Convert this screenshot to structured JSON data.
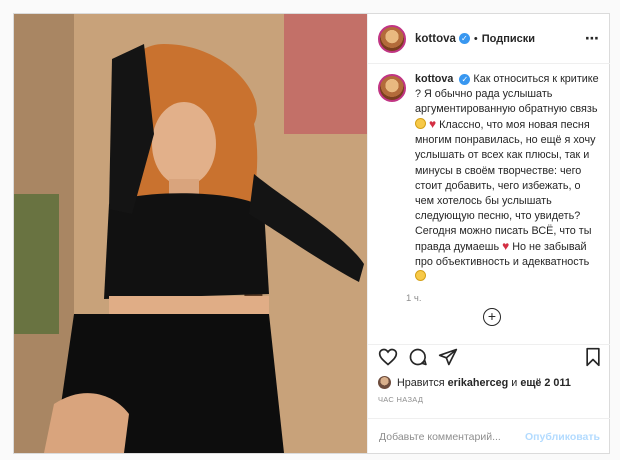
{
  "post": {
    "username": "kottova",
    "follow_label": "Подписки",
    "separator": "•",
    "caption": {
      "p1": "Как относиться к критике ? Я обычно рада услышать аргументированную обратную связь",
      "p2": " Классно, что моя новая песня многим понравилась, но ещё я хочу услышать от всех как плюсы, так и минусы в своём творчестве: чего стоит добавить, чего избежать, о чем хотелось бы услышать следующую песню, что увидеть? Сегодня можно писать ВСЁ, что ты правда думаешь",
      "p3": " Но не забывай про объективность и адекватность"
    },
    "comment_time": "1 ч.",
    "likes": {
      "prefix": "Нравится",
      "user": "erikaherceg",
      "and": "и",
      "others": "ещё 2 011"
    },
    "time_ago": "ЧАС НАЗАД",
    "add_comment_placeholder": "Добавьте комментарий...",
    "publish_label": "Опубликовать",
    "icons": [
      "more-icon",
      "verified-icon",
      "heart-icon",
      "comment-icon",
      "share-icon",
      "bookmark-icon",
      "load-more-icon"
    ],
    "colors": {
      "accent": "#3897f0",
      "publish": "#b3dbff",
      "heart_emoji": "#d32f43"
    }
  }
}
